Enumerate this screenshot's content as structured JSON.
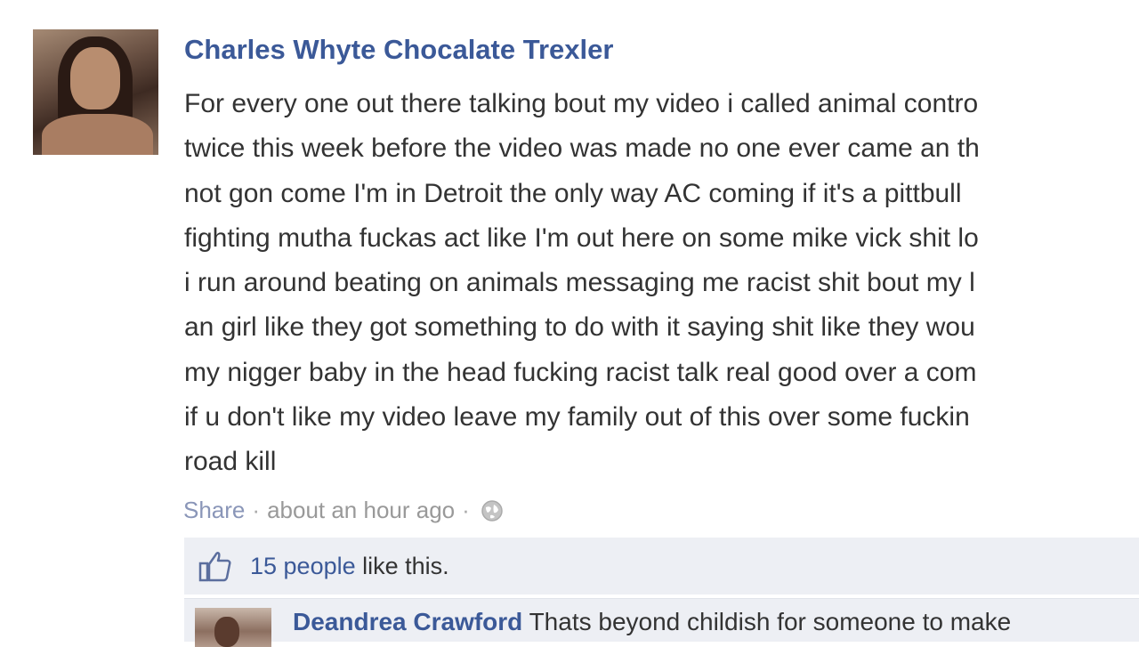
{
  "post": {
    "author": "Charles Whyte Chocalate Trexler",
    "message_lines": [
      "For every one out there talking bout my video i called animal contro",
      "twice this week before the video was made no one ever came an th",
      "not gon come I'm in Detroit the only way AC coming if it's a pittbull",
      "fighting mutha fuckas act like I'm out here on some mike vick shit lo",
      "i run around beating on animals messaging me racist shit bout my l",
      "an girl like they got something to do with it saying shit like they wou",
      "my nigger baby in the head fucking racist talk real good over a com",
      "if u don't like my video leave my family out of this over some fuckin",
      "road kill"
    ],
    "meta": {
      "share_label": "Share",
      "separator": "·",
      "timestamp": "about an hour ago",
      "privacy_icon": "globe-icon"
    },
    "likes": {
      "count_text": "15 people",
      "suffix_text": " like this.",
      "icon": "thumbs-up-icon"
    }
  },
  "comment": {
    "author": "Deandrea Crawford",
    "text": " Thats beyond childish for someone to make"
  },
  "colors": {
    "link": "#3b5998",
    "text": "#333333",
    "meta": "#999999",
    "box_bg": "#edeff4"
  }
}
